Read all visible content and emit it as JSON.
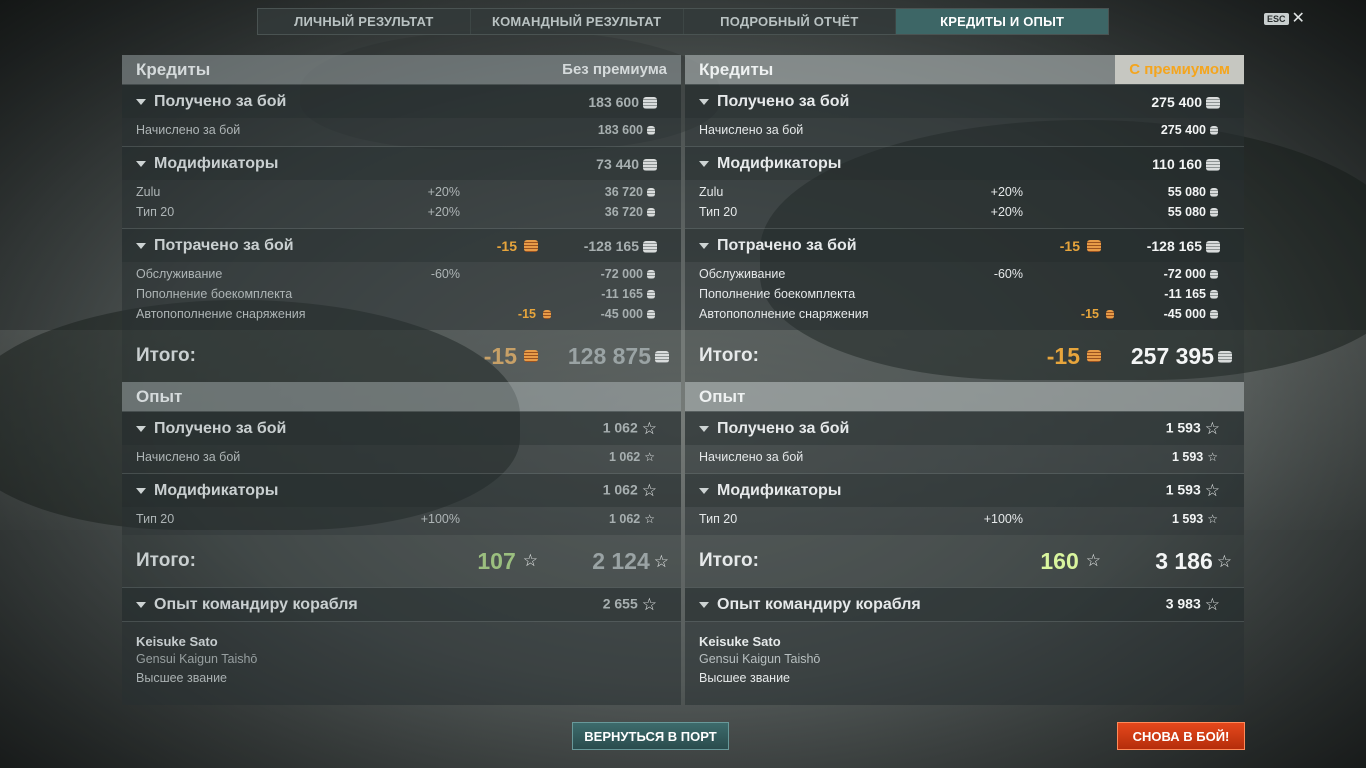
{
  "tabs": [
    {
      "label": "ЛИЧНЫЙ РЕЗУЛЬТАТ"
    },
    {
      "label": "КОМАНДНЫЙ РЕЗУЛЬТАТ"
    },
    {
      "label": "ПОДРОБНЫЙ ОТЧЁТ"
    },
    {
      "label": "КРЕДИТЫ И ОПЫТ"
    }
  ],
  "active_tab": "КРЕДИТЫ И ОПЫТ",
  "esc_label": "ESC",
  "close_symbol": "✕",
  "left": {
    "credits_title": "Кредиты",
    "mode": "Без премиума",
    "received": {
      "label": "Получено за бой",
      "value": "183 600"
    },
    "accrued": {
      "label": "Начислено за бой",
      "value": "183 600"
    },
    "modifiers": {
      "label": "Модификаторы",
      "value": "73 440"
    },
    "mod_rows": [
      {
        "label": "Zulu",
        "pct": "+20%",
        "value": "36 720"
      },
      {
        "label": "Тип 20",
        "pct": "+20%",
        "value": "36 720"
      }
    ],
    "spent": {
      "label": "Потрачено за бой",
      "extra": "-15",
      "value": "-128 165"
    },
    "spent_rows": [
      {
        "label": "Обслуживание",
        "pct": "-60%",
        "extra": "",
        "value": "-72 000"
      },
      {
        "label": "Пополнение боекомплекта",
        "pct": "",
        "extra": "",
        "value": "-11 165"
      },
      {
        "label": "Автопополнение снаряжения",
        "pct": "",
        "extra": "-15",
        "value": "-45 000"
      }
    ],
    "credits_total": {
      "label": "Итого:",
      "extra": "-15",
      "value": "128 875"
    },
    "exp_title": "Опыт",
    "exp_received": {
      "label": "Получено за бой",
      "value": "1 062"
    },
    "exp_accrued": {
      "label": "Начислено за бой",
      "value": "1 062"
    },
    "exp_modifiers": {
      "label": "Модификаторы",
      "value": "1 062"
    },
    "exp_mod_rows": [
      {
        "label": "Тип 20",
        "pct": "+100%",
        "value": "1 062"
      }
    ],
    "exp_total": {
      "label": "Итого:",
      "extra": "107",
      "value": "2 124"
    },
    "commander_exp": {
      "label": "Опыт командиру корабля",
      "value": "2 655"
    },
    "commander": {
      "name": "Keisuke Sato",
      "rank": "Gensui Kaigun Taishō",
      "status": "Высшее звание"
    }
  },
  "right": {
    "credits_title": "Кредиты",
    "mode": "С премиумом",
    "received": {
      "label": "Получено за бой",
      "value": "275 400"
    },
    "accrued": {
      "label": "Начислено за бой",
      "value": "275 400"
    },
    "modifiers": {
      "label": "Модификаторы",
      "value": "110 160"
    },
    "mod_rows": [
      {
        "label": "Zulu",
        "pct": "+20%",
        "value": "55 080"
      },
      {
        "label": "Тип 20",
        "pct": "+20%",
        "value": "55 080"
      }
    ],
    "spent": {
      "label": "Потрачено за бой",
      "extra": "-15",
      "value": "-128 165"
    },
    "spent_rows": [
      {
        "label": "Обслуживание",
        "pct": "-60%",
        "extra": "",
        "value": "-72 000"
      },
      {
        "label": "Пополнение боекомплекта",
        "pct": "",
        "extra": "",
        "value": "-11 165"
      },
      {
        "label": "Автопополнение снаряжения",
        "pct": "",
        "extra": "-15",
        "value": "-45 000"
      }
    ],
    "credits_total": {
      "label": "Итого:",
      "extra": "-15",
      "value": "257 395"
    },
    "exp_title": "Опыт",
    "exp_received": {
      "label": "Получено за бой",
      "value": "1 593"
    },
    "exp_accrued": {
      "label": "Начислено за бой",
      "value": "1 593"
    },
    "exp_modifiers": {
      "label": "Модификаторы",
      "value": "1 593"
    },
    "exp_mod_rows": [
      {
        "label": "Тип 20",
        "pct": "+100%",
        "value": "1 593"
      }
    ],
    "exp_total": {
      "label": "Итого:",
      "extra": "160",
      "value": "3 186"
    },
    "commander_exp": {
      "label": "Опыт командиру корабля",
      "value": "3 983"
    },
    "commander": {
      "name": "Keisuke Sato",
      "rank": "Gensui Kaigun Taishō",
      "status": "Высшее звание"
    }
  },
  "buttons": {
    "port": "ВЕРНУТЬСЯ В ПОРТ",
    "battle": "СНОВА В БОЙ!"
  },
  "colors": {
    "accent": "#3d6666",
    "premium": "#f4a51e",
    "battle_button": "#d63c14",
    "free_exp": "#d9f59e"
  },
  "icons": {
    "credits": "silver-coins-icon",
    "doubloons": "gold-coins-icon",
    "experience": "star-icon"
  }
}
